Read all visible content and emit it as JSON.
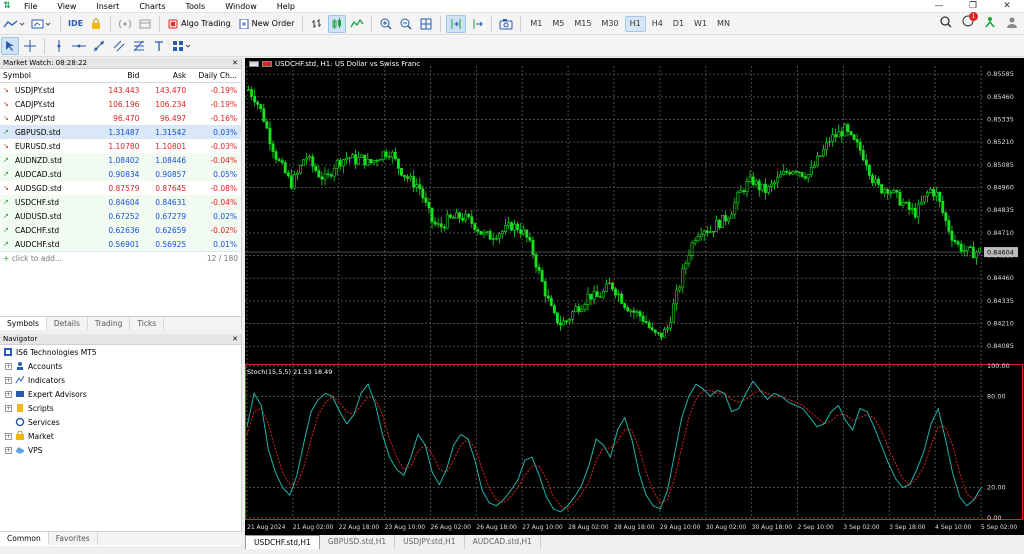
{
  "menu": {
    "items": [
      "File",
      "View",
      "Insert",
      "Charts",
      "Tools",
      "Window",
      "Help"
    ]
  },
  "toolbar": {
    "ide_label": "IDE",
    "algo_label": "Algo Trading",
    "new_order_label": "New Order",
    "timeframes": [
      "M1",
      "M5",
      "M15",
      "M30",
      "H1",
      "H4",
      "D1",
      "W1",
      "MN"
    ],
    "active_timeframe": "H1",
    "notification_count": "1"
  },
  "market_watch": {
    "title": "Market Watch: 08:28:22",
    "headers": {
      "symbol": "Symbol",
      "bid": "Bid",
      "ask": "Ask",
      "change": "Daily Ch..."
    },
    "rows": [
      {
        "symbol": "USDJPY.std",
        "bid": "143.443",
        "ask": "143.470",
        "change": "-0.19%",
        "dir": "dn"
      },
      {
        "symbol": "CADJPY.std",
        "bid": "106.196",
        "ask": "106.234",
        "change": "-0.19%",
        "dir": "dn"
      },
      {
        "symbol": "AUDJPY.std",
        "bid": "96.470",
        "ask": "96.497",
        "change": "-0.16%",
        "dir": "dn"
      },
      {
        "symbol": "GBPUSD.std",
        "bid": "1.31487",
        "ask": "1.31542",
        "change": "0.03%",
        "dir": "up"
      },
      {
        "symbol": "EURUSD.std",
        "bid": "1.10780",
        "ask": "1.10801",
        "change": "-0.03%",
        "dir": "dn"
      },
      {
        "symbol": "AUDNZD.std",
        "bid": "1.08402",
        "ask": "1.08446",
        "change": "-0.04%",
        "dir": "up"
      },
      {
        "symbol": "AUDCAD.std",
        "bid": "0.90834",
        "ask": "0.90857",
        "change": "0.05%",
        "dir": "up"
      },
      {
        "symbol": "AUDSGD.std",
        "bid": "0.87579",
        "ask": "0.87645",
        "change": "-0.08%",
        "dir": "dn"
      },
      {
        "symbol": "USDCHF.std",
        "bid": "0.84604",
        "ask": "0.84631",
        "change": "-0.04%",
        "dir": "up"
      },
      {
        "symbol": "AUDUSD.std",
        "bid": "0.67252",
        "ask": "0.67279",
        "change": "0.02%",
        "dir": "up"
      },
      {
        "symbol": "CADCHF.std",
        "bid": "0.62636",
        "ask": "0.62659",
        "change": "-0.02%",
        "dir": "up"
      },
      {
        "symbol": "AUDCHF.std",
        "bid": "0.56901",
        "ask": "0.56925",
        "change": "0.01%",
        "dir": "up"
      }
    ],
    "add_label": "click to add...",
    "count": "12 / 180",
    "tabs": [
      "Symbols",
      "Details",
      "Trading",
      "Ticks"
    ]
  },
  "navigator": {
    "title": "Navigator",
    "root": "IS6 Technologies MT5",
    "items": [
      "Accounts",
      "Indicators",
      "Expert Advisors",
      "Scripts",
      "Services",
      "Market",
      "VPS"
    ],
    "tabs": [
      "Common",
      "Favorites"
    ]
  },
  "chart": {
    "title": "USDCHF.std, H1:  US Dollar vs Swiss Franc",
    "stoch_label": "Stoch(15,5,5) 21.53 18.49",
    "current_price": "0.84604",
    "tabs": [
      "USDCHF.std,H1",
      "GBPUSD.std,H1",
      "USDJPY.std,H1",
      "AUDCAD.std,H1"
    ]
  },
  "chart_data": {
    "type": "candlestick",
    "price_ticks": [
      "0.85585",
      "0.85460",
      "0.85335",
      "0.85210",
      "0.85085",
      "0.84960",
      "0.84835",
      "0.84710",
      "0.84585",
      "0.84460",
      "0.84335",
      "0.84210",
      "0.84085"
    ],
    "ylim": [
      0.8402,
      0.8563
    ],
    "stoch_ticks": [
      "100.00",
      "80.00",
      "20.00",
      "0.00"
    ],
    "x_labels": [
      "21 Aug 2024",
      "21 Aug 02:00",
      "22 Aug 18:00",
      "23 Aug 10:00",
      "26 Aug 02:00",
      "26 Aug 18:00",
      "27 Aug 10:00",
      "28 Aug 02:00",
      "28 Aug 18:00",
      "29 Aug 10:00",
      "30 Aug 02:00",
      "30 Aug 18:00",
      "2 Sep 10:00",
      "3 Sep 02:00",
      "3 Sep 18:00",
      "4 Sep 10:00",
      "5 Sep 02:00"
    ],
    "close_path": [
      0.855,
      0.8545,
      0.8536,
      0.8523,
      0.8512,
      0.8505,
      0.8498,
      0.8504,
      0.8514,
      0.8508,
      0.8503,
      0.85,
      0.8508,
      0.8511,
      0.8513,
      0.8511,
      0.8512,
      0.8509,
      0.8512,
      0.8515,
      0.8516,
      0.8508,
      0.8503,
      0.8499,
      0.8497,
      0.8486,
      0.8476,
      0.8474,
      0.8478,
      0.8479,
      0.848,
      0.8478,
      0.8475,
      0.847,
      0.8469,
      0.8471,
      0.8472,
      0.8475,
      0.8474,
      0.847,
      0.8461,
      0.8448,
      0.8436,
      0.8425,
      0.8421,
      0.8423,
      0.8429,
      0.8432,
      0.8437,
      0.8435,
      0.8438,
      0.8443,
      0.8438,
      0.8432,
      0.8428,
      0.8426,
      0.8422,
      0.8415,
      0.8414,
      0.8418,
      0.8432,
      0.8446,
      0.846,
      0.847,
      0.8474,
      0.8472,
      0.8476,
      0.8478,
      0.8483,
      0.8491,
      0.8497,
      0.85,
      0.8496,
      0.8494,
      0.8498,
      0.8502,
      0.8505,
      0.8507,
      0.8504,
      0.8503,
      0.851,
      0.8516,
      0.8523,
      0.8525,
      0.8528,
      0.8522,
      0.8518,
      0.8511,
      0.85,
      0.8495,
      0.8496,
      0.8492,
      0.8488,
      0.8484,
      0.8482,
      0.8488,
      0.8495,
      0.8492,
      0.848,
      0.847,
      0.8464,
      0.8461,
      0.846,
      0.8461
    ],
    "stoch_k": [
      60,
      82,
      74,
      45,
      30,
      20,
      15,
      28,
      50,
      70,
      78,
      82,
      80,
      70,
      62,
      68,
      82,
      88,
      75,
      55,
      40,
      32,
      28,
      40,
      55,
      48,
      30,
      22,
      32,
      48,
      55,
      52,
      38,
      18,
      10,
      8,
      12,
      18,
      25,
      38,
      40,
      28,
      14,
      6,
      4,
      8,
      14,
      22,
      35,
      52,
      48,
      40,
      58,
      66,
      52,
      30,
      15,
      8,
      6,
      18,
      42,
      66,
      80,
      88,
      85,
      80,
      84,
      82,
      70,
      72,
      82,
      90,
      84,
      78,
      82,
      80,
      76,
      74,
      72,
      66,
      60,
      62,
      70,
      74,
      64,
      58,
      72,
      70,
      60,
      48,
      36,
      26,
      20,
      22,
      32,
      44,
      62,
      72,
      52,
      30,
      14,
      8,
      12,
      20
    ],
    "stoch_d": [
      55,
      70,
      72,
      62,
      45,
      30,
      22,
      22,
      34,
      52,
      68,
      76,
      80,
      76,
      70,
      68,
      74,
      80,
      78,
      68,
      52,
      40,
      32,
      34,
      44,
      48,
      42,
      32,
      30,
      38,
      48,
      52,
      46,
      32,
      20,
      12,
      10,
      14,
      20,
      28,
      34,
      34,
      26,
      14,
      8,
      6,
      10,
      16,
      24,
      38,
      46,
      46,
      50,
      58,
      58,
      46,
      30,
      18,
      10,
      12,
      26,
      46,
      66,
      78,
      84,
      84,
      82,
      82,
      78,
      76,
      78,
      82,
      84,
      82,
      80,
      80,
      78,
      76,
      74,
      70,
      66,
      62,
      64,
      68,
      68,
      64,
      66,
      68,
      66,
      58,
      46,
      36,
      26,
      22,
      26,
      34,
      48,
      60,
      60,
      48,
      30,
      16,
      12,
      16
    ]
  }
}
